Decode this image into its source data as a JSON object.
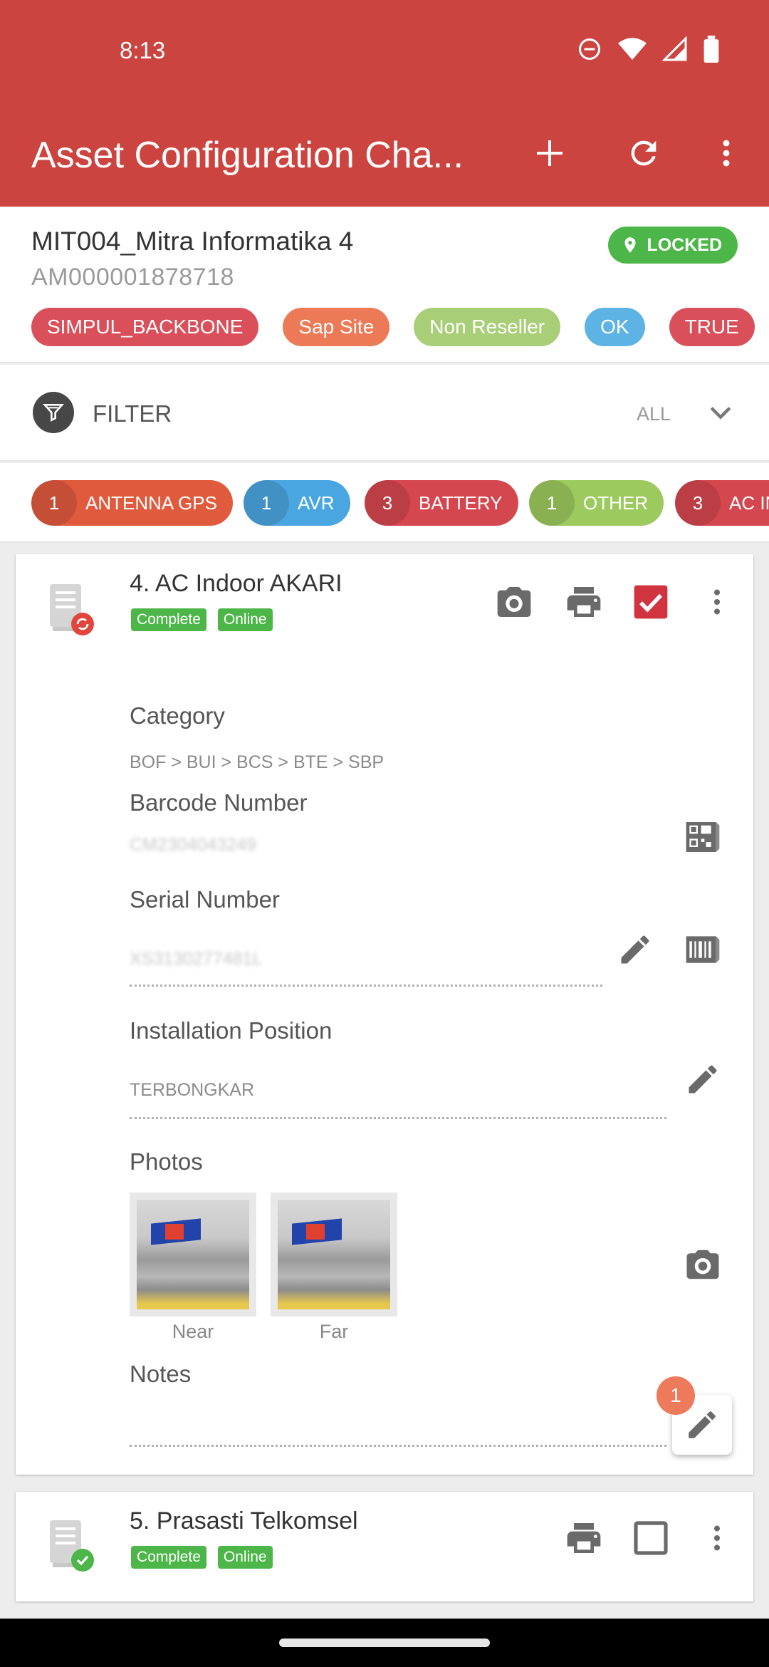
{
  "status_bar": {
    "time": "8:13"
  },
  "app_bar": {
    "title": "Asset Configuration Cha..."
  },
  "site": {
    "name": "MIT004_Mitra Informatika 4",
    "asset_id": "AM000001878718",
    "lock_status": "LOCKED",
    "tags": [
      {
        "label": "SIMPUL_BACKBONE",
        "color": "#d9505a"
      },
      {
        "label": "Sap Site",
        "color": "#ec7a56"
      },
      {
        "label": "Non Reseller",
        "color": "#a8cf77"
      },
      {
        "label": "OK",
        "color": "#5db3e4"
      },
      {
        "label": "TRUE",
        "color": "#d9505a"
      }
    ]
  },
  "filter": {
    "label": "FILTER",
    "value": "ALL"
  },
  "categories": [
    {
      "count": "1",
      "label": "ANTENNA GPS",
      "color": "#e05a3e"
    },
    {
      "count": "1",
      "label": "AVR",
      "color": "#4aa6e0"
    },
    {
      "count": "3",
      "label": "BATTERY",
      "color": "#d5474f"
    },
    {
      "count": "1",
      "label": "OTHER",
      "color": "#9cca5e"
    },
    {
      "count": "3",
      "label": "AC IN",
      "color": "#d5474f"
    }
  ],
  "assets": [
    {
      "title": "4. AC Indoor AKARI",
      "status": "Complete",
      "connection": "Online",
      "checked": true,
      "fields": {
        "category_label": "Category",
        "category_value": "BOF > BUI > BCS > BTE > SBP",
        "barcode_label": "Barcode Number",
        "barcode_value": "CM2304043249",
        "serial_label": "Serial Number",
        "serial_value": "XS3130277481L",
        "position_label": "Installation Position",
        "position_value": "TERBONGKAR",
        "photos_label": "Photos",
        "photos": [
          {
            "caption": "Near"
          },
          {
            "caption": "Far"
          }
        ],
        "notes_label": "Notes"
      },
      "notes_badge": "1"
    },
    {
      "title": "5. Prasasti Telkomsel",
      "status": "Complete",
      "connection": "Online",
      "checked": false
    }
  ],
  "colors": {
    "primary": "#cc4440",
    "success": "#4cb648"
  }
}
